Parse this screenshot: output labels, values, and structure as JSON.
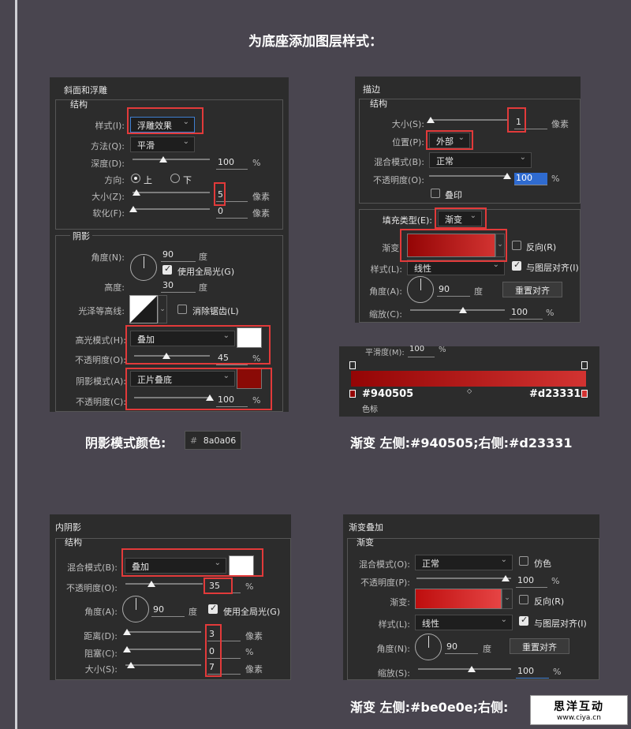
{
  "title": "为底座添加图层样式：",
  "bevel": {
    "header": "斜面和浮雕",
    "structure": "结构",
    "style_label": "样式(I):",
    "style_value": "浮雕效果",
    "technique_label": "方法(Q):",
    "technique_value": "平滑",
    "depth_label": "深度(D):",
    "depth_value": "100",
    "depth_unit": "%",
    "direction_label": "方向:",
    "dir_up": "上",
    "dir_down": "下",
    "size_label": "大小(Z):",
    "size_value": "5",
    "size_unit": "像素",
    "soften_label": "软化(F):",
    "soften_value": "0",
    "soften_unit": "像素",
    "shading": "阴影",
    "angle_label": "角度(N):",
    "angle_value": "90",
    "angle_unit": "度",
    "global_light": "使用全局光(G)",
    "altitude_label": "高度:",
    "altitude_value": "30",
    "altitude_unit": "度",
    "contour_label": "光泽等高线:",
    "antialias": "消除锯齿(L)",
    "highlight_label": "高光模式(H):",
    "highlight_value": "叠加",
    "h_opacity_label": "不透明度(O):",
    "h_opacity_value": "45",
    "h_opacity_unit": "%",
    "shadow_label": "阴影模式(A):",
    "shadow_value": "正片叠底",
    "s_opacity_label": "不透明度(C):",
    "s_opacity_value": "100",
    "s_opacity_unit": "%",
    "highlight_color": "#ffffff",
    "shadow_color": "#8a0a06"
  },
  "shadow_caption": {
    "label": "阴影模式颜色:",
    "hash": "#",
    "hex": "8a0a06"
  },
  "stroke": {
    "header": "描边",
    "structure": "结构",
    "size_label": "大小(S):",
    "size_value": "1",
    "size_unit": "像素",
    "position_label": "位置(P):",
    "position_value": "外部",
    "blend_label": "混合模式(B):",
    "blend_value": "正常",
    "opacity_label": "不透明度(O):",
    "opacity_value": "100",
    "opacity_unit": "%",
    "overprint": "叠印",
    "fill_type_label": "填充类型(E):",
    "fill_type_value": "渐变",
    "gradient_label": "渐变:",
    "reverse": "反向(R)",
    "style_label": "样式(L):",
    "style_value": "线性",
    "align": "与图层对齐(I)",
    "angle_label": "角度(A):",
    "angle_value": "90",
    "angle_unit": "度",
    "reset_button": "重置对齐",
    "scale_label": "缩放(C):",
    "scale_value": "100",
    "scale_unit": "%"
  },
  "gradient_editor": {
    "smooth_label": "平滑度(M):",
    "smooth_value": "100",
    "smooth_unit": "%",
    "left_hex": "#940505",
    "right_hex": "#d23331",
    "stops_label": "色标"
  },
  "stroke_caption": "渐变 左侧:#940505;右侧:#d23331",
  "inner_shadow": {
    "header": "内阴影",
    "structure": "结构",
    "blend_label": "混合模式(B):",
    "blend_value": "叠加",
    "opacity_label": "不透明度(O):",
    "opacity_value": "35",
    "opacity_unit": "%",
    "angle_label": "角度(A):",
    "angle_value": "90",
    "angle_unit": "度",
    "global_light": "使用全局光(G)",
    "distance_label": "距离(D):",
    "distance_value": "3",
    "distance_unit": "像素",
    "choke_label": "阻塞(C):",
    "choke_value": "0",
    "choke_unit": "%",
    "size_label": "大小(S):",
    "size_value": "7",
    "size_unit": "像素",
    "color": "#ffffff"
  },
  "gradient_overlay": {
    "header": "渐变叠加",
    "section": "渐变",
    "blend_label": "混合模式(O):",
    "blend_value": "正常",
    "dither": "仿色",
    "opacity_label": "不透明度(P):",
    "opacity_value": "100",
    "opacity_unit": "%",
    "gradient_label": "渐变:",
    "reverse": "反向(R)",
    "style_label": "样式(L):",
    "style_value": "线性",
    "align": "与图层对齐(I)",
    "angle_label": "角度(N):",
    "angle_value": "90",
    "angle_unit": "度",
    "reset_button": "重置对齐",
    "scale_label": "缩放(S):",
    "scale_value": "100",
    "scale_unit": "%"
  },
  "overlay_caption": "渐变 左侧:#be0e0e;右侧:",
  "watermark": {
    "cn": "思洋互动",
    "url": "www.ciya.cn"
  }
}
